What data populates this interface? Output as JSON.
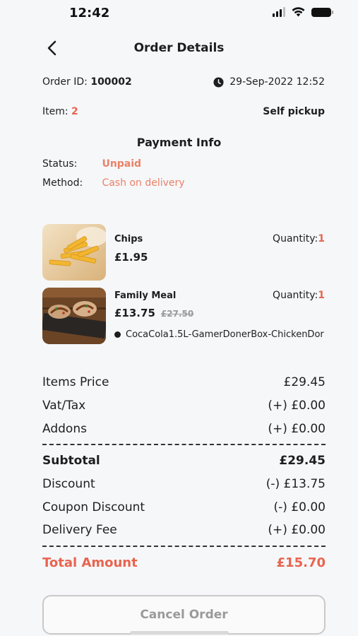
{
  "status_bar": {
    "time": "12:42"
  },
  "header": {
    "title": "Order Details"
  },
  "order": {
    "id_label": "Order ID:",
    "id_value": "100002",
    "date": "29-Sep-2022 12:52",
    "item_label": "Item:",
    "item_count": "2",
    "delivery_type": "Self pickup"
  },
  "payment": {
    "title": "Payment Info",
    "status_label": "Status:",
    "status_value": "Unpaid",
    "method_label": "Method:",
    "method_value": "Cash on delivery"
  },
  "products": [
    {
      "name": "Chips",
      "quantity_label": "Quantity:",
      "quantity": "1",
      "price": "£1.95",
      "image": "fries-photo"
    },
    {
      "name": "Family Meal",
      "quantity_label": "Quantity:",
      "quantity": "1",
      "price": "£13.75",
      "old_price": "£27.50",
      "addons": "CocaCola1.5L-GamerDonerBox-ChickenDor",
      "image": "meal-photo"
    }
  ],
  "summary": {
    "items_price": {
      "label": "Items Price",
      "value": "£29.45"
    },
    "vat": {
      "label": "Vat/Tax",
      "value": "(+) £0.00"
    },
    "addons": {
      "label": "Addons",
      "value": "(+) £0.00"
    },
    "subtotal": {
      "label": "Subtotal",
      "value": "£29.45"
    },
    "discount": {
      "label": "Discount",
      "value": "(-) £13.75"
    },
    "coupon": {
      "label": "Coupon Discount",
      "value": "(-) £0.00"
    },
    "delivery": {
      "label": "Delivery Fee",
      "value": "(+) £0.00"
    },
    "total": {
      "label": "Total Amount",
      "value": "£15.70"
    }
  },
  "actions": {
    "cancel_label": "Cancel Order"
  },
  "colors": {
    "accent": "#e8644f",
    "background": "#f6f7f9"
  }
}
